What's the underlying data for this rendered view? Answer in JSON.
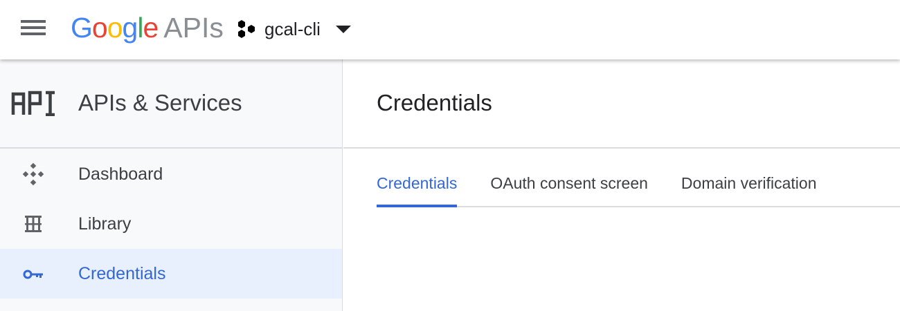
{
  "topbar": {
    "logo": {
      "letters": [
        "G",
        "o",
        "o",
        "g",
        "l",
        "e"
      ],
      "suffix": "APIs"
    },
    "project": {
      "name": "gcal-cli"
    }
  },
  "sidebar": {
    "title": "APIs & Services",
    "header_icon": "api-icon",
    "items": [
      {
        "label": "Dashboard",
        "icon": "dashboard-icon",
        "active": false
      },
      {
        "label": "Library",
        "icon": "library-icon",
        "active": false
      },
      {
        "label": "Credentials",
        "icon": "key-icon",
        "active": true
      }
    ]
  },
  "main": {
    "title": "Credentials",
    "tabs": [
      {
        "label": "Credentials",
        "active": true
      },
      {
        "label": "OAuth consent screen",
        "active": false
      },
      {
        "label": "Domain verification",
        "active": false
      }
    ]
  },
  "colors": {
    "accent": "#3367d6",
    "active_bg": "#e8f0fe",
    "sidebar_bg": "#f8f9fa",
    "google_blue": "#4285f4",
    "google_red": "#ea4335",
    "google_yellow": "#fbbc05",
    "google_green": "#34a853"
  }
}
